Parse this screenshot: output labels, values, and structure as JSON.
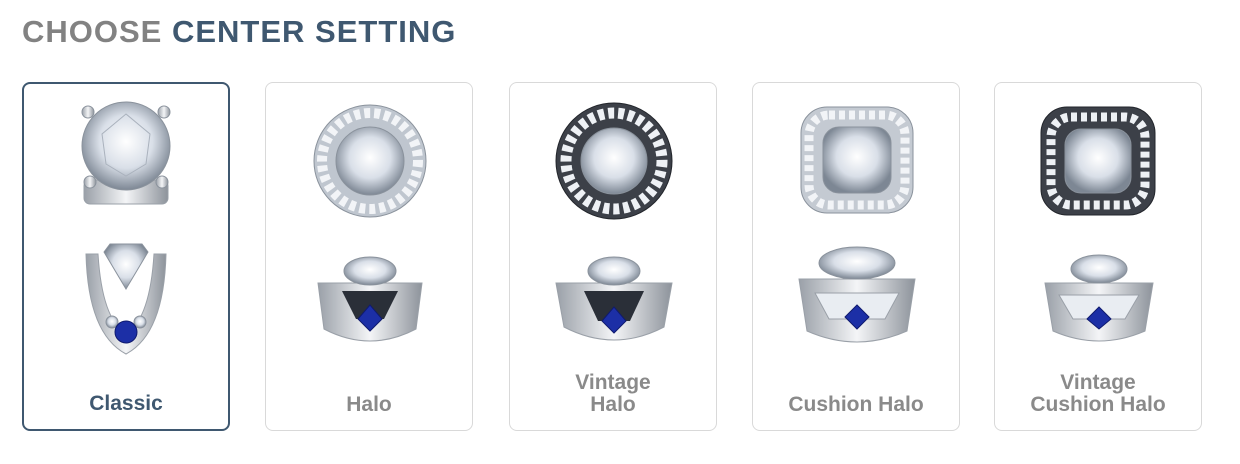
{
  "header": {
    "prefix": "CHOOSE",
    "title": "CENTER SETTING"
  },
  "selected_index": 0,
  "colors": {
    "accent": "#3f5870",
    "muted_text": "#8a8a8a",
    "card_border": "#d9d9d9",
    "sapphire": "#1c2fa6"
  },
  "options": [
    {
      "label_lines": [
        "Classic"
      ],
      "top_view": "solitaire-prong",
      "side_view": "solitaire-side"
    },
    {
      "label_lines": [
        "Halo"
      ],
      "top_view": "round-halo",
      "side_view": "halo-side"
    },
    {
      "label_lines": [
        "Vintage",
        "Halo"
      ],
      "top_view": "round-vintage-halo",
      "side_view": "halo-side"
    },
    {
      "label_lines": [
        "Cushion Halo"
      ],
      "top_view": "cushion-halo",
      "side_view": "cushion-side"
    },
    {
      "label_lines": [
        "Vintage",
        "Cushion Halo"
      ],
      "top_view": "cushion-vintage-halo",
      "side_view": "cushion-side"
    }
  ]
}
